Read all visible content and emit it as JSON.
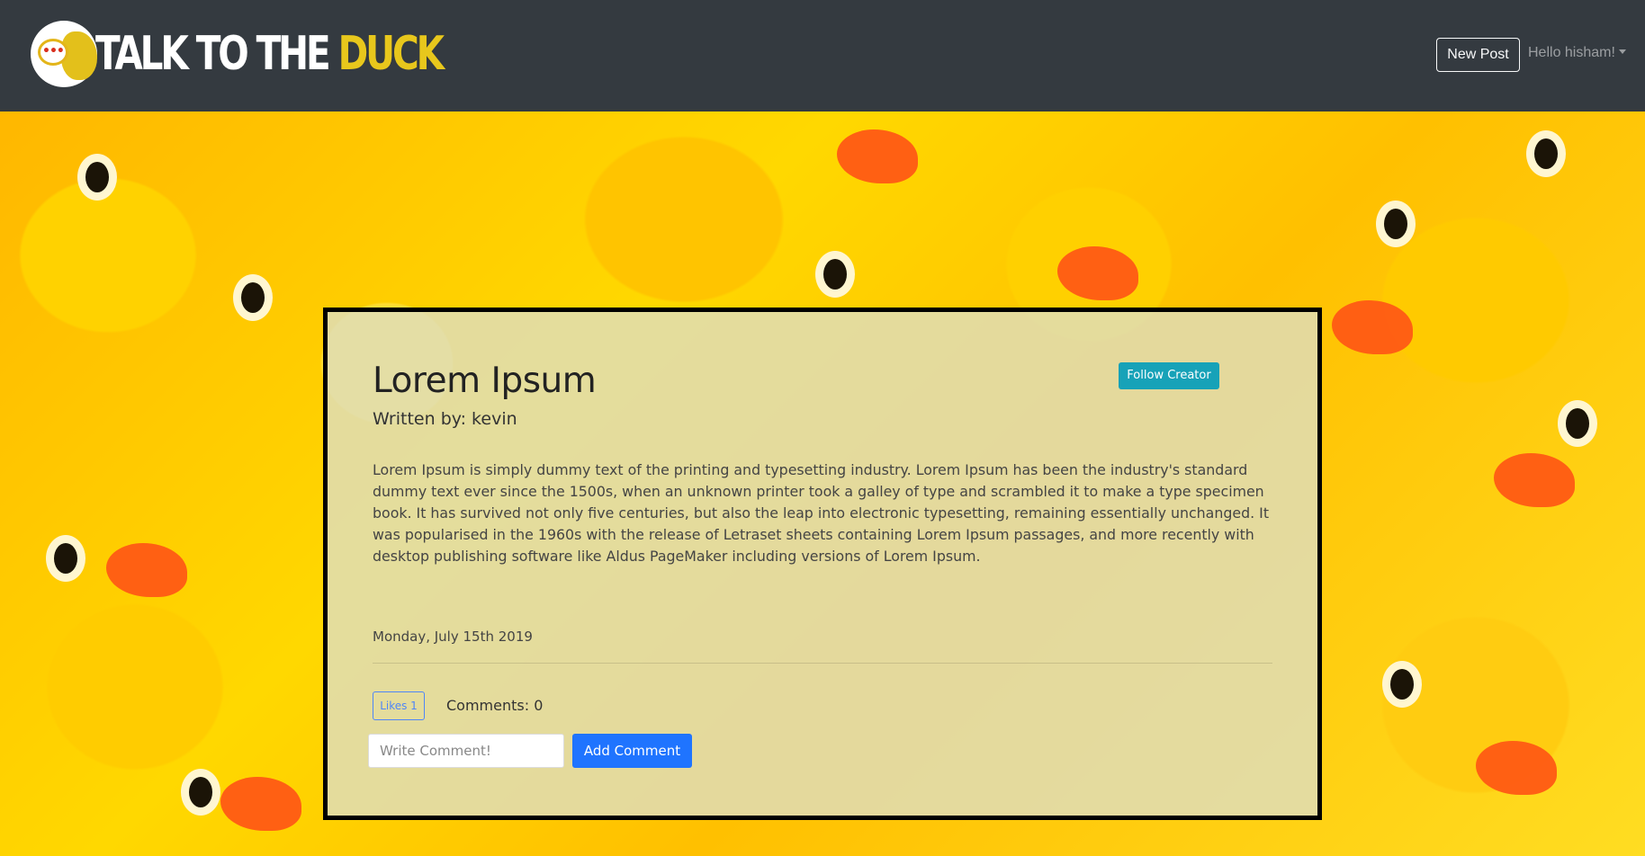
{
  "navbar": {
    "logo": {
      "text_white": "TALK TO THE ",
      "text_yellow": "DUCK",
      "icon": "duck-speech-bubble-logo-icon"
    },
    "new_post_label": "New Post",
    "user_menu_label": "Hello hisham!"
  },
  "post": {
    "title": "Lorem Ipsum",
    "author": "Written by: kevin",
    "follow_label": "Follow Creator",
    "body": "Lorem Ipsum is simply dummy text of the printing and typesetting industry. Lorem Ipsum has been the industry's standard dummy text ever since the 1500s, when an unknown printer took a galley of type and scrambled it to make a type specimen book. It has survived not only five centuries, but also the leap into electronic typesetting, remaining essentially unchanged. It was popularised in the 1960s with the release of Letraset sheets containing Lorem Ipsum passages, and more recently with desktop publishing software like Aldus PageMaker including versions of Lorem Ipsum.",
    "date": "Monday, July 15th 2019",
    "likes_label": "Likes 1",
    "comments_label": "Comments: 0"
  },
  "comment_form": {
    "placeholder": "Write Comment!",
    "value": "",
    "submit_label": "Add Comment"
  },
  "colors": {
    "navbar_bg": "#343a40",
    "logo_yellow": "#e8c71c",
    "follow_button": "#17a2b8",
    "primary_button": "#1f74ff",
    "likes_outline": "#4f86f7"
  }
}
